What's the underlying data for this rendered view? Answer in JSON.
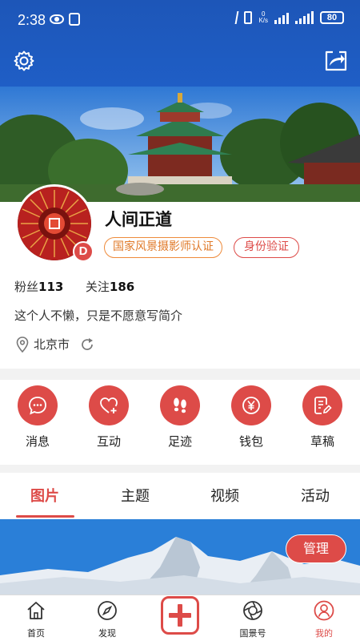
{
  "status_bar": {
    "time": "2:38",
    "net_speed_top": "0",
    "net_speed_unit": "K/s",
    "battery": "80"
  },
  "toolbar": {
    "settings_icon": "gear-icon",
    "share_icon": "share-icon"
  },
  "profile": {
    "name": "人间正道",
    "avatar_badge": "D",
    "certification": "国家风景摄影师认证",
    "identity_verify": "身份验证",
    "followers_label": "粉丝",
    "followers_count": "113",
    "following_label": "关注",
    "following_count": "186",
    "bio": "这个人不懒，只是不愿意写简介",
    "location": "北京市"
  },
  "actions": [
    {
      "label": "消息",
      "icon": "message-icon"
    },
    {
      "label": "互动",
      "icon": "heart-plus-icon"
    },
    {
      "label": "足迹",
      "icon": "footprint-icon"
    },
    {
      "label": "钱包",
      "icon": "yen-coin-icon"
    },
    {
      "label": "草稿",
      "icon": "draft-icon"
    }
  ],
  "tabs": [
    {
      "label": "图片",
      "active": true
    },
    {
      "label": "主题",
      "active": false
    },
    {
      "label": "视频",
      "active": false
    },
    {
      "label": "活动",
      "active": false
    }
  ],
  "content": {
    "manage_label": "管理"
  },
  "bottom_nav": [
    {
      "label": "首页",
      "icon": "home-icon",
      "active": false
    },
    {
      "label": "发现",
      "icon": "compass-icon",
      "active": false
    },
    {
      "label": "",
      "icon": "add-icon",
      "active": false
    },
    {
      "label": "国景号",
      "icon": "aperture-icon",
      "active": false
    },
    {
      "label": "我的",
      "icon": "user-icon",
      "active": true
    }
  ],
  "colors": {
    "accent": "#dd4b48",
    "header_blue": "#1f5ec6",
    "cert_orange": "#e07a2a"
  }
}
